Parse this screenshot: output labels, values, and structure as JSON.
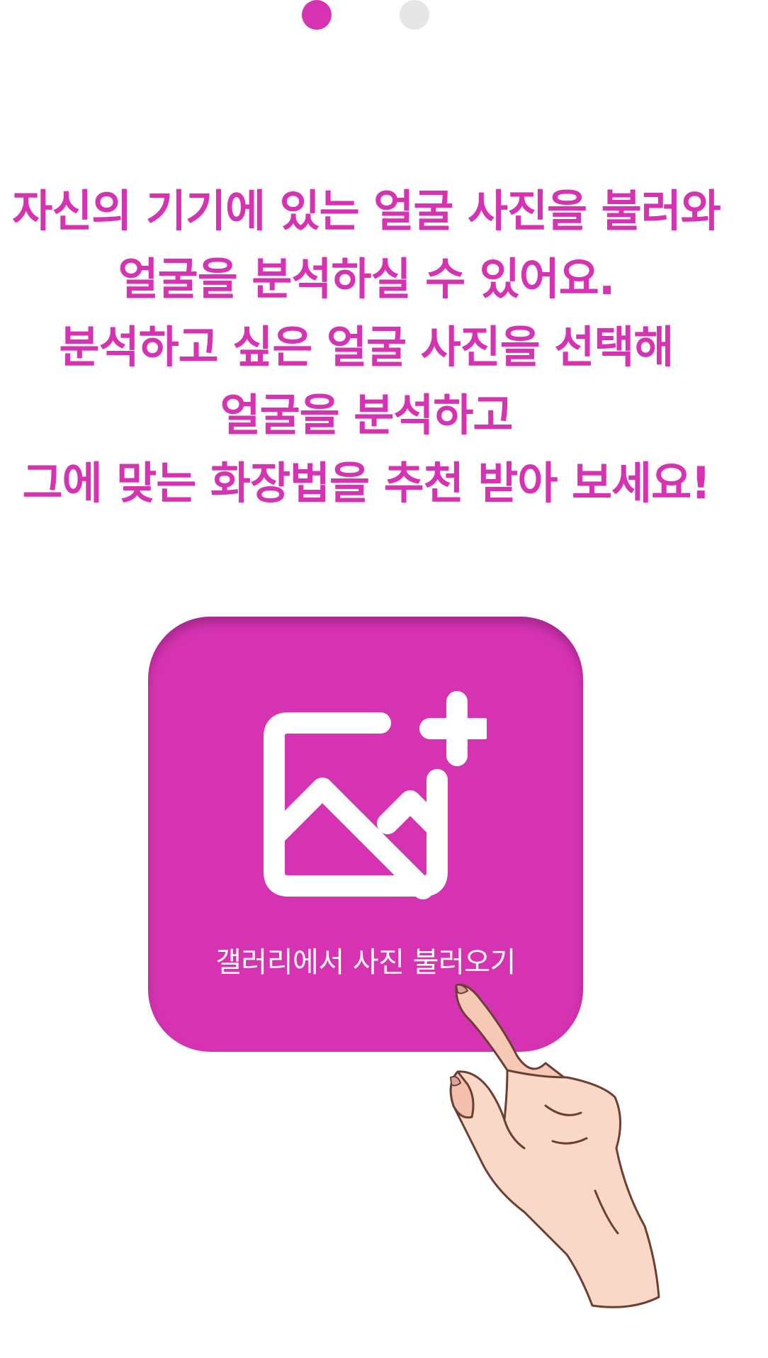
{
  "colors": {
    "accent": "#D633B2",
    "dot_inactive": "#E6E6E6",
    "white": "#FFFFFF"
  },
  "pager": {
    "page_count": 2,
    "active_index": 0
  },
  "headline": {
    "lines": [
      "자신의 기기에 있는 얼굴 사진을 불러와",
      "얼굴을 분석하실 수 있어요.",
      "분석하고 싶은 얼굴 사진을 선택해",
      "얼굴을 분석하고",
      "그에 맞는 화장법을 추천 받아 보세요!"
    ]
  },
  "gallery_button": {
    "label": "갤러리에서 사진 불러오기",
    "icon": "add-image-icon"
  },
  "illustration": {
    "icon": "pointing-hand-icon"
  }
}
